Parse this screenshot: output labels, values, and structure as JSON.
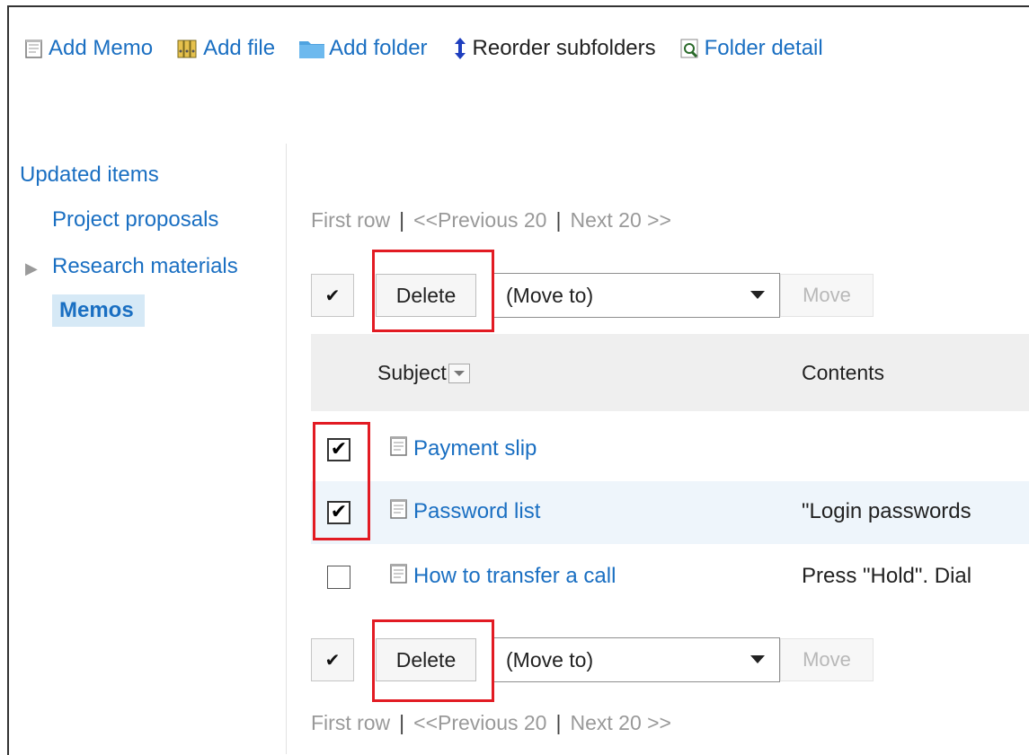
{
  "toolbar": {
    "add_memo": "Add Memo",
    "add_file": "Add file",
    "add_folder": "Add folder",
    "reorder_subfolders": "Reorder subfolders",
    "folder_details": "Folder detail"
  },
  "sidebar": {
    "top": "Updated items",
    "items": [
      {
        "label": "Project proposals"
      },
      {
        "label": "Research materials"
      }
    ],
    "current": "Memos"
  },
  "pager": {
    "first": "First row",
    "sep": "|",
    "previous": "<<Previous 20",
    "next": "Next 20 >>"
  },
  "actions": {
    "check_all": "✔",
    "delete": "Delete",
    "move_to": "(Move to)",
    "move": "Move"
  },
  "table": {
    "headers": {
      "subject": "Subject",
      "contents": "Contents"
    },
    "rows": [
      {
        "subject": "Payment slip",
        "contents": "",
        "checked": true
      },
      {
        "subject": "Password list",
        "contents": "\"Login passwords",
        "checked": true
      },
      {
        "subject": "How to transfer a call",
        "contents": "Press \"Hold\". Dial",
        "checked": false
      }
    ]
  },
  "colors": {
    "link": "#1a6fc2",
    "highlight": "#e21b23",
    "current_bg": "#d6e9f6"
  }
}
